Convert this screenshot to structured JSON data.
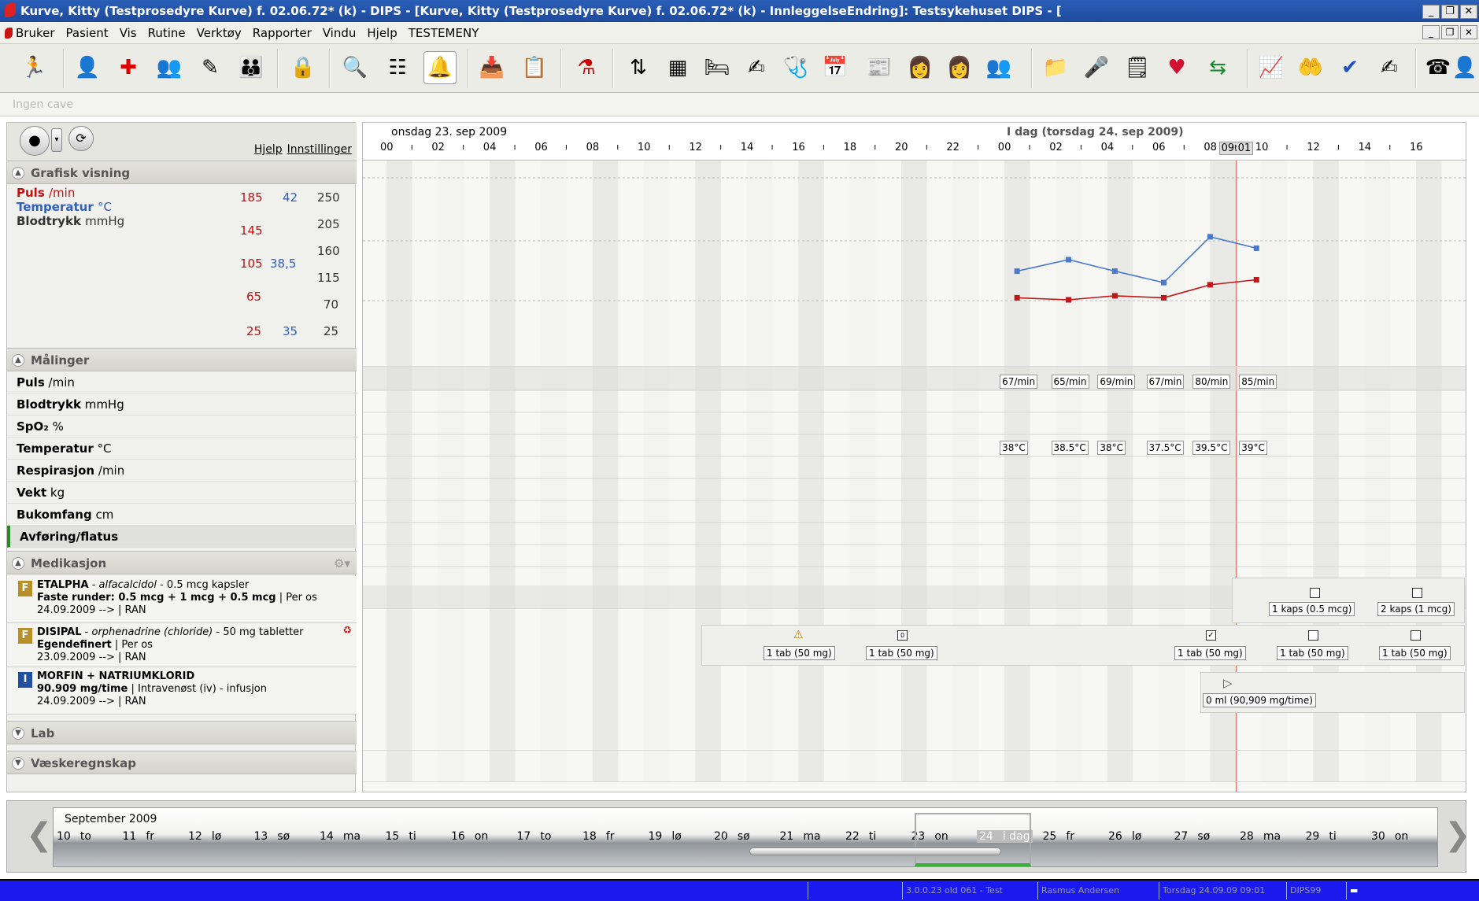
{
  "window": {
    "title": "Kurve, Kitty (Testprosedyre Kurve) f. 02.06.72* (k) - DIPS - [Kurve, Kitty (Testprosedyre Kurve) f. 02.06.72* (k) - InnleggelseEndring]: Testsykehuset DIPS - ["
  },
  "menu": [
    "Bruker",
    "Pasient",
    "Vis",
    "Rutine",
    "Verktøy",
    "Rapporter",
    "Vindu",
    "Hjelp",
    "TESTEMENY"
  ],
  "cave": "Ingen cave",
  "left": {
    "links": [
      "Hjelp",
      "Innstillinger"
    ],
    "grafisk": {
      "title": "Grafisk visning",
      "labels": [
        {
          "name": "Puls",
          "unit": "/min",
          "color": "#c01010"
        },
        {
          "name": "Temperatur",
          "unit": "°C",
          "color": "#3060c0"
        },
        {
          "name": "Blodtrykk",
          "unit": "mmHg",
          "color": "#333333"
        }
      ],
      "puls_scale": [
        "185",
        "145",
        "105",
        "65",
        "25"
      ],
      "temp_scale": [
        "42",
        "38,5",
        "35"
      ],
      "bp_scale": [
        "250",
        "205",
        "160",
        "115",
        "70",
        "25"
      ]
    },
    "malinger": {
      "title": "Målinger",
      "rows": [
        {
          "name": "Puls",
          "unit": "/min"
        },
        {
          "name": "Blodtrykk",
          "unit": "mmHg"
        },
        {
          "name": "SpO₂",
          "unit": "%"
        },
        {
          "name": "Temperatur",
          "unit": "°C"
        },
        {
          "name": "Respirasjon",
          "unit": "/min"
        },
        {
          "name": "Vekt",
          "unit": "kg"
        },
        {
          "name": "Bukomfang",
          "unit": "cm"
        },
        {
          "name": "Avføring/flatus",
          "unit": ""
        }
      ]
    },
    "medikasjon": {
      "title": "Medikasjon",
      "items": [
        {
          "badge": "F",
          "badge_color": "#b8902a",
          "l1a": "ETALPHA",
          "l1b": "alfacalcidol",
          "l1c": "- 0.5 mcg kapsler",
          "l2a": "Faste runder: 0.5 mcg + 1 mcg + 0.5 mcg",
          "l2b": "| Per os",
          "l3": "24.09.2009 -->  | RAN"
        },
        {
          "badge": "F",
          "badge_color": "#b8902a",
          "l1a": "DISIPAL",
          "l1b": "orphenadrine (chloride)",
          "l1c": "- 50 mg tabletter",
          "l2a": "Egendefinert",
          "l2b": "| Per os",
          "l3": "23.09.2009 -->  | RAN"
        },
        {
          "badge": "I",
          "badge_color": "#2050a0",
          "l1a": "MORFIN + NATRIUMKLORID",
          "l1b": "",
          "l1c": "",
          "l2a": "90.909 mg/time",
          "l2b": "| Intravenøst (iv) - infusjon",
          "l3": "24.09.2009 -->  | RAN"
        }
      ]
    },
    "lab": "Lab",
    "vaske": "Væskeregnskap"
  },
  "timeline": {
    "day1": "onsdag 23. sep 2009",
    "day2": "I dag (torsdag 24. sep 2009)",
    "hours": [
      "00",
      "02",
      "04",
      "06",
      "08",
      "10",
      "12",
      "14",
      "16",
      "18",
      "20",
      "22",
      "00",
      "02",
      "04",
      "06",
      "08",
      "09:01",
      "10",
      "12",
      "14",
      "16"
    ],
    "now_marker": "09:01"
  },
  "chart_data": {
    "type": "line",
    "x_unit": "hours since 23 sep 00:00",
    "x": [
      24.5,
      26.5,
      28.3,
      30.2,
      32,
      33.8
    ],
    "series": [
      {
        "name": "Temperatur",
        "color": "#4a7ad0",
        "values": [
          38,
          38.5,
          38,
          37.5,
          39.5,
          39
        ]
      },
      {
        "name": "Puls",
        "color": "#c01818",
        "values": [
          67,
          65,
          69,
          67,
          80,
          85
        ]
      }
    ]
  },
  "measurements": {
    "puls": [
      "67/min",
      "65/min",
      "69/min",
      "67/min",
      "80/min",
      "85/min"
    ],
    "temp": [
      "38°C",
      "38.5°C",
      "38°C",
      "37.5°C",
      "39.5°C",
      "39°C"
    ]
  },
  "med_grid": {
    "etalpha": [
      "1 kaps (0.5 mcg)",
      "2 kaps (1 mcg)"
    ],
    "disipal": [
      "1 tab (50 mg)",
      "1 tab (50 mg)",
      "1 tab (50 mg)",
      "1 tab (50 mg)",
      "1 tab (50 mg)"
    ],
    "morfin": [
      "0 ml (90,909 mg/time)"
    ]
  },
  "calendar": {
    "month": "September 2009",
    "days": [
      [
        "10",
        "to"
      ],
      [
        "11",
        "fr"
      ],
      [
        "12",
        "lø"
      ],
      [
        "13",
        "sø"
      ],
      [
        "14",
        "ma"
      ],
      [
        "15",
        "ti"
      ],
      [
        "16",
        "on"
      ],
      [
        "17",
        "to"
      ],
      [
        "18",
        "fr"
      ],
      [
        "19",
        "lø"
      ],
      [
        "20",
        "sø"
      ],
      [
        "21",
        "ma"
      ],
      [
        "22",
        "ti"
      ],
      [
        "23",
        "on"
      ],
      [
        "24",
        "i dag"
      ],
      [
        "25",
        "fr"
      ],
      [
        "26",
        "lø"
      ],
      [
        "27",
        "sø"
      ],
      [
        "28",
        "ma"
      ],
      [
        "29",
        "ti"
      ],
      [
        "30",
        "on"
      ]
    ]
  },
  "status": [
    "3.0.0.23 old 061 - Test",
    "Rasmus Andersen",
    "Torsdag 24.09.09 09:01",
    "DIPS99"
  ]
}
